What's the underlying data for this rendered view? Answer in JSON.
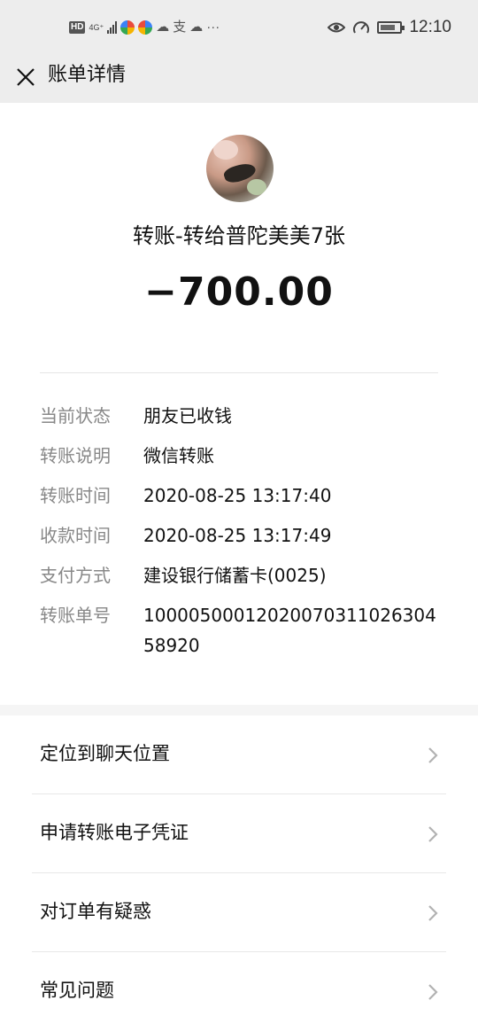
{
  "status_bar": {
    "left_badge": "HD",
    "network_type": "4G⁺",
    "left_extra_glyph": "支",
    "more": "···",
    "time": "12:10",
    "icons": [
      "hd-icon",
      "signal-icon",
      "app-notification-icon",
      "app-notification-icon",
      "cloud-icon",
      "alipay-icon",
      "cloud-icon",
      "more-icon",
      "eye-icon",
      "speed-icon",
      "battery-icon"
    ]
  },
  "nav": {
    "title": "账单详情",
    "close_icon": "close-icon"
  },
  "summary": {
    "title": "转账-转给普陀美美7张",
    "amount": "−700.00"
  },
  "details": [
    {
      "label": "当前状态",
      "value": "朋友已收钱"
    },
    {
      "label": "转账说明",
      "value": "微信转账"
    },
    {
      "label": "转账时间",
      "value": "2020-08-25 13:17:40"
    },
    {
      "label": "收款时间",
      "value": "2020-08-25 13:17:49"
    },
    {
      "label": "支付方式",
      "value": "建设银行储蓄卡(0025)"
    },
    {
      "label": "转账单号",
      "value": "1000050001202007031102630458920"
    }
  ],
  "menu": [
    {
      "label": "定位到聊天位置"
    },
    {
      "label": "申请转账电子凭证"
    },
    {
      "label": "对订单有疑惑"
    },
    {
      "label": "常见问题"
    }
  ],
  "colors": {
    "header_bg": "#ededed",
    "label_gray": "#888888",
    "text": "#111111",
    "divider": "#e6e6e6"
  }
}
